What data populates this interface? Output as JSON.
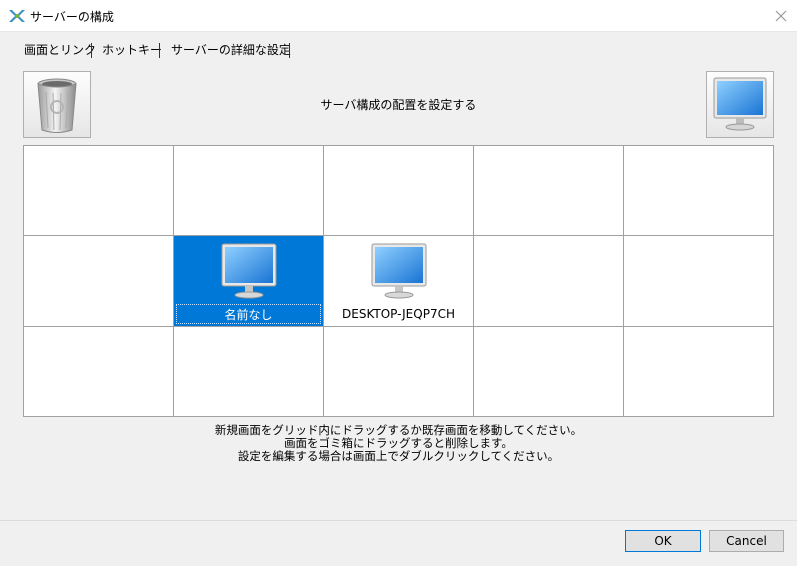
{
  "window": {
    "title": "サーバーの構成",
    "icon": "server-config-icon",
    "close_icon": "close-icon"
  },
  "tabs": [
    {
      "label": "画面とリンク",
      "active": true
    },
    {
      "label": "ホットキー",
      "active": false
    },
    {
      "label": "サーバーの詳細な設定",
      "active": false
    }
  ],
  "layout": {
    "title": "サーバ構成の配置を設定する",
    "trash_icon": "trash-icon",
    "new_screen_icon": "monitor-icon"
  },
  "grid": {
    "columns": 5,
    "rows": 3,
    "screens": [
      {
        "name": "名前なし",
        "row": 1,
        "col": 1,
        "selected": true
      },
      {
        "name": "DESKTOP-JEQP7CH",
        "row": 1,
        "col": 2,
        "selected": false
      }
    ]
  },
  "instructions": {
    "line1": "新規画面をグリッド内にドラッグするか既存画面を移動してください。",
    "line2": "画面をゴミ箱にドラッグすると削除します。",
    "line3": "設定を編集する場合は画面上でダブルクリックしてください。"
  },
  "footer": {
    "ok_label": "OK",
    "cancel_label": "Cancel"
  },
  "colors": {
    "selection": "#0078d7",
    "grid_line": "#a0a0a0",
    "dialog_bg": "#f0f0f0"
  }
}
